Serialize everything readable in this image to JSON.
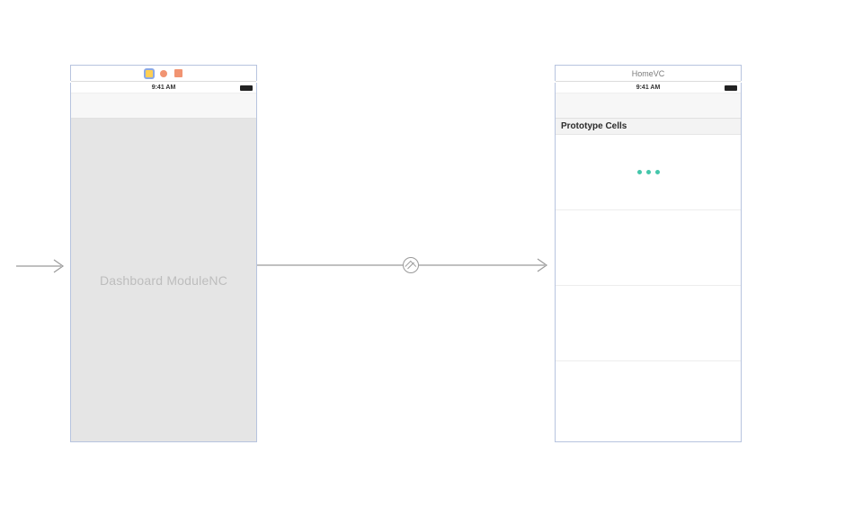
{
  "scenes": {
    "left": {
      "header_type": "icons",
      "statusbar_time": "9:41 AM",
      "placeholder": "Dashboard ModuleNC"
    },
    "right": {
      "title": "HomeVC",
      "statusbar_time": "9:41 AM",
      "section_header": "Prototype Cells"
    }
  }
}
